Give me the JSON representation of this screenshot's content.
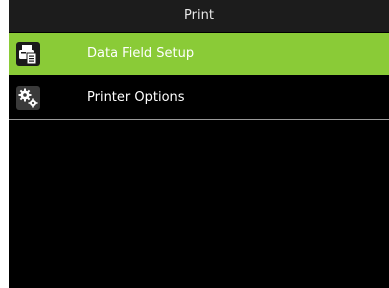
{
  "header": {
    "title": "Print"
  },
  "menu": {
    "items": [
      {
        "label": "Data Field Setup",
        "icon": "printer-document-icon",
        "selected": true
      },
      {
        "label": "Printer Options",
        "icon": "gears-icon",
        "selected": false
      }
    ]
  },
  "colors": {
    "selected_background": "#8acb37",
    "screen_background": "#000000",
    "title_bar_background": "#1c1c1c",
    "text": "#ffffff"
  }
}
